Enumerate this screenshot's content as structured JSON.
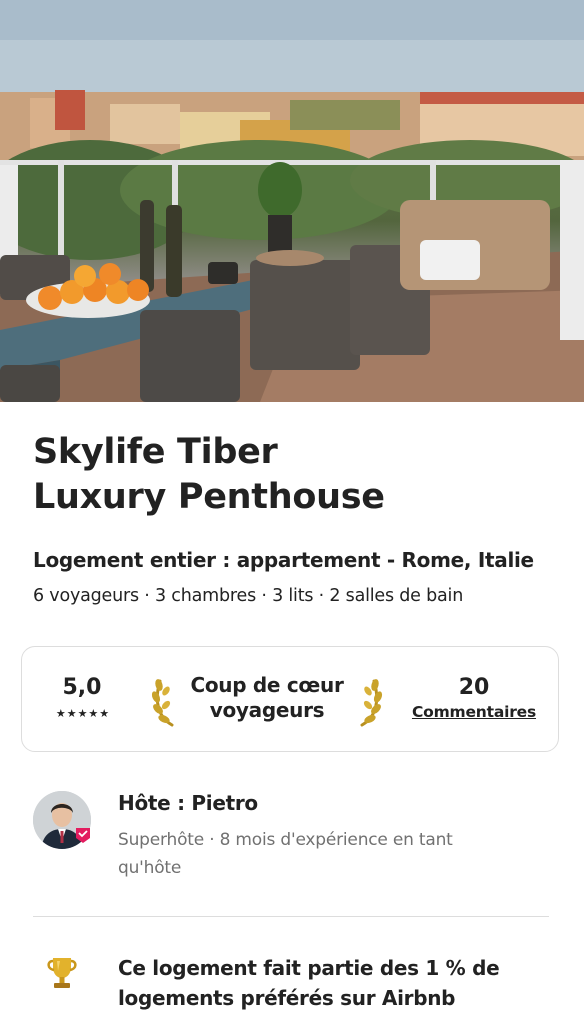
{
  "listing": {
    "title_line1": "Skylife Tiber",
    "title_line2": "Luxury Penthouse",
    "subtitle": "Logement entier : appartement - Rome, Italie",
    "details": "6 voyageurs · 3 chambres · 3 lits · 2 salles de bain"
  },
  "rating_card": {
    "rating": "5,0",
    "stars": "★★★★★",
    "star_count": 5,
    "favorite_line1": "Coup de cœur",
    "favorite_line2": "voyageurs",
    "reviews_count": "20",
    "reviews_label": "Commentaires"
  },
  "host": {
    "name": "Hôte : Pietro",
    "subtitle": "Superhôte · 8 mois d'expérience en tant qu'hôte",
    "avatar_icon": "host-avatar",
    "badge_icon": "superhost-badge-icon",
    "badge_color": "#E31C5F"
  },
  "highlight": {
    "icon": "trophy-icon",
    "text": "Ce logement fait partie des 1 % de logements préférés sur Airbnb"
  },
  "colors": {
    "text_primary": "#222222",
    "text_secondary": "#717171",
    "border": "#DDDDDD",
    "accent": "#E31C5F"
  }
}
